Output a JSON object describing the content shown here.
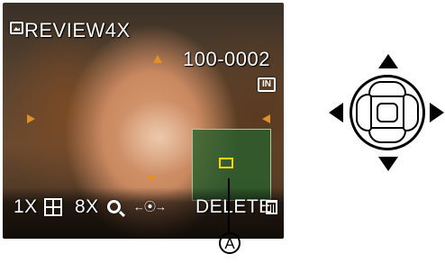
{
  "screen": {
    "review_label": "REVIEW4X",
    "file_number": "100-0002",
    "mode_badge": "IN",
    "bottom_bar": {
      "zoom_min": "1X",
      "zoom_max": "8X",
      "lr_indicator": "←⦿→",
      "delete_label": "DELETE"
    }
  },
  "callout": {
    "label": "A"
  },
  "icons": {
    "review": "play-review-icon",
    "grid": "multi-view-icon",
    "magnify": "magnify-icon",
    "trash": "trash-icon"
  },
  "colors": {
    "osd_text": "#ffffff",
    "focus_marker": "#e0902a",
    "zoom_box": "#285f2d",
    "zoom_frame": "#ffd400"
  }
}
